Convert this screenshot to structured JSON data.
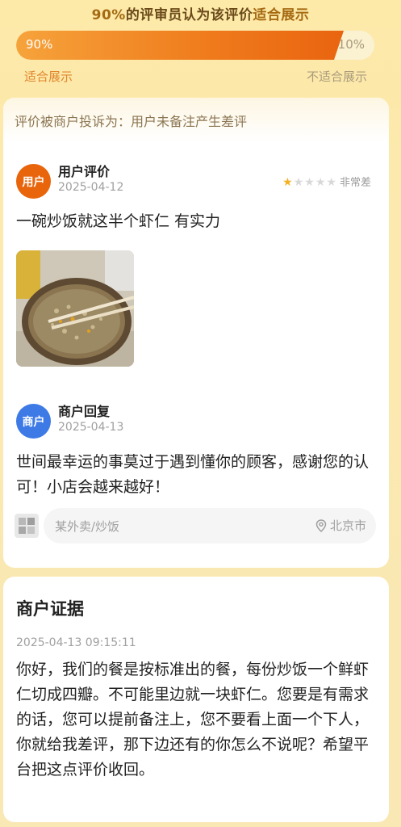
{
  "header": {
    "title_pct": "90%",
    "title_mid": "的评审员认为该评价",
    "title_end": "适合展示"
  },
  "vote": {
    "yes_pct": "90%",
    "no_pct": "10%",
    "yes_fraction": 0.9,
    "yes_label": "适合展示",
    "no_label": "不适合展示"
  },
  "review": {
    "complaint": "评价被商户投诉为：用户未备注产生差评",
    "user": {
      "avatar_text": "用户",
      "name": "用户评价",
      "date": "2025-04-12",
      "stars_filled": 1,
      "stars_total": 5,
      "rating_text": "非常差",
      "content": "一碗炒饭就这半个虾仁 有实力"
    },
    "merchant": {
      "avatar_text": "商户",
      "name": "商户回复",
      "date": "2025-04-13",
      "content": "世间最幸运的事莫过于遇到懂你的顾客，感谢您的认可！小店会越来越好！"
    },
    "shop": {
      "name": "某外卖/炒饭",
      "location": "北京市"
    }
  },
  "evidence": {
    "title": "商户证据",
    "time": "2025-04-13 09:15:11",
    "content": "你好，我们的餐是按标准出的餐，每份炒饭一个鲜虾仁切成四瓣。不可能里边就一块虾仁。您要是有需求的话，您可以提前备注上，您不要看上面一个下人，你就给我差评，那下边还有的你怎么不说呢？希望平台把这点评价收回。"
  },
  "colors": {
    "accent_orange": "#e9640f",
    "merchant_blue": "#3d7ae6",
    "star_gold": "#f5b021"
  }
}
